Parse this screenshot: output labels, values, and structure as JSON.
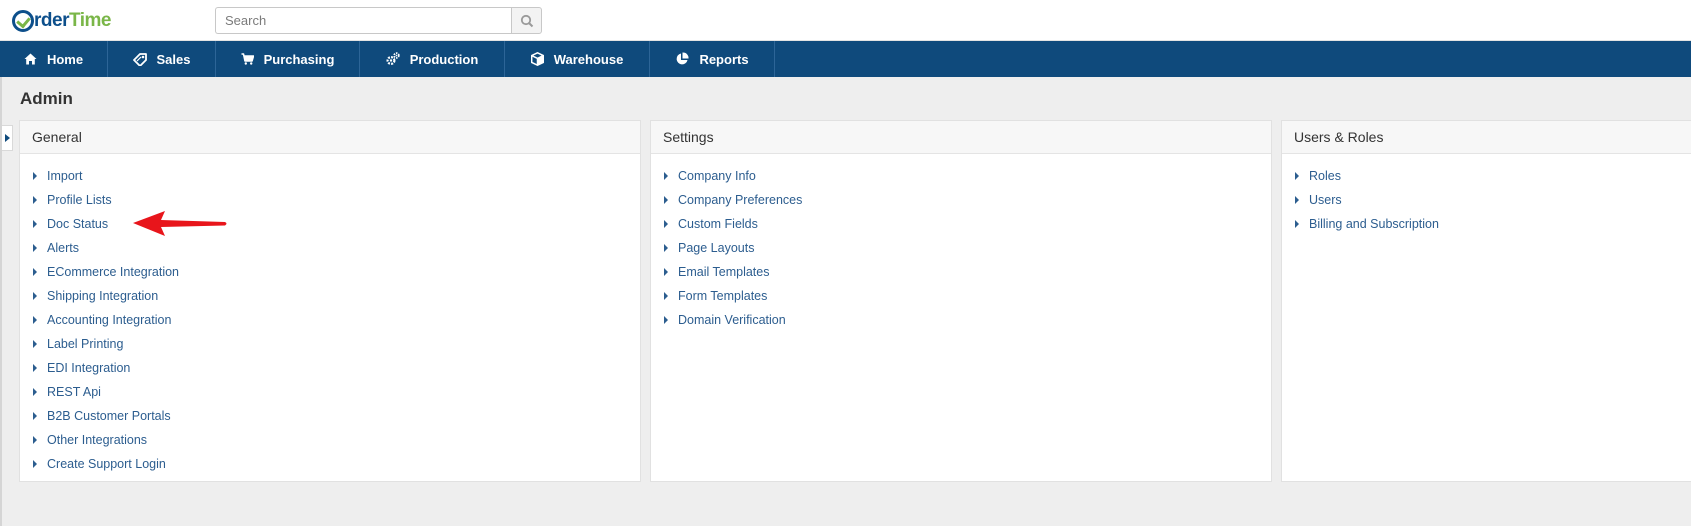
{
  "brand": {
    "part1": "rder",
    "part2": "Time",
    "first_letter": "O"
  },
  "search": {
    "placeholder": "Search",
    "value": ""
  },
  "nav": [
    {
      "label": "Home",
      "icon": "home-icon"
    },
    {
      "label": "Sales",
      "icon": "tag-icon"
    },
    {
      "label": "Purchasing",
      "icon": "cart-icon"
    },
    {
      "label": "Production",
      "icon": "gears-icon"
    },
    {
      "label": "Warehouse",
      "icon": "box-icon"
    },
    {
      "label": "Reports",
      "icon": "pie-chart-icon"
    }
  ],
  "page_title": "Admin",
  "panels": [
    {
      "title": "General",
      "links": [
        "Import",
        "Profile Lists",
        "Doc Status",
        "Alerts",
        "ECommerce Integration",
        "Shipping Integration",
        "Accounting Integration",
        "Label Printing",
        "EDI Integration",
        "REST Api",
        "B2B Customer Portals",
        "Other Integrations",
        "Create Support Login"
      ]
    },
    {
      "title": "Settings",
      "links": [
        "Company Info",
        "Company Preferences",
        "Custom Fields",
        "Page Layouts",
        "Email Templates",
        "Form Templates",
        "Domain Verification"
      ]
    },
    {
      "title": "Users & Roles",
      "links": [
        "Roles",
        "Users",
        "Billing and Subscription"
      ]
    }
  ],
  "annotation": {
    "icon": "red-arrow-icon",
    "color": "#e8151b",
    "points_to": "Doc Status"
  },
  "colors": {
    "nav_bg": "#0f4a7c",
    "link": "#2c5d8f",
    "brand_blue": "#0d4f8b",
    "brand_green": "#7ab648"
  }
}
